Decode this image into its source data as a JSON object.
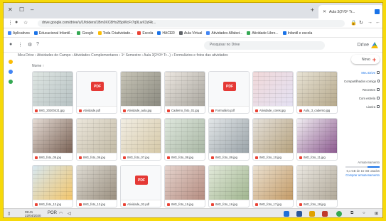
{
  "window": {
    "tab_title": "Aula 3(2ª/3ª Tr...",
    "new_tab": "+",
    "minimize": "–",
    "maximize": "☐",
    "close": "✕"
  },
  "address_bar": {
    "url": "drive.google.com/drive/u/1/folders/1Bm0XC8Hx2l5pWcFr7q9LwX3zRk..."
  },
  "bookmarks": [
    {
      "label": "Aplicativos",
      "color": "#4285f4"
    },
    {
      "label": "Educacional Infantil...",
      "color": "#1a73e8"
    },
    {
      "label": "Google",
      "color": "#34a853"
    },
    {
      "label": "Toda Criatividade...",
      "color": "#fbbc04"
    },
    {
      "label": "Escola",
      "color": "#ea4335"
    },
    {
      "label": "HACER",
      "color": "#1a73e8"
    },
    {
      "label": "Aula Virtual",
      "color": "#5f6368"
    },
    {
      "label": "Atividades Alfabet...",
      "color": "#4285f4"
    },
    {
      "label": "Atividade Libro...",
      "color": "#34a853"
    },
    {
      "label": "Infantil e escola",
      "color": "#1a73e8"
    }
  ],
  "drive": {
    "logo_text": "Drive",
    "search_placeholder": "Pesquisar no Drive",
    "path": "Meu Drive  ›  Atividades do Campo  ›  Atividades Complementares  ›  1º Semestre  ›  Aula 3(2ª/3ª Tr...)  ›  Formulários e fotos das atividades"
  },
  "sidebar": {
    "new_label": "Novo",
    "items": [
      {
        "label": "Meu Drive",
        "active": true
      },
      {
        "label": "Compartilhados comigo",
        "active": false
      },
      {
        "label": "Recentes",
        "active": false
      },
      {
        "label": "Com estrela",
        "active": false
      },
      {
        "label": "Lixeira",
        "active": false
      }
    ],
    "storage_label": "Armazenamento",
    "storage_used_fraction": 0.35,
    "storage_text": "6,1 GB de 15 GB usados",
    "storage_link": "Comprar armazenamento"
  },
  "grid": {
    "header_name": "Nome",
    "header_sort": "↑",
    "files": [
      {
        "name": "IMG_20200421.jpg",
        "type": "image",
        "colors": [
          "#dfe6e3",
          "#b7c2c3"
        ],
        "icon_color": "#ea4335"
      },
      {
        "name": "Atividade.pdf",
        "type": "pdf",
        "icon_color": "#ea4335"
      },
      {
        "name": "Atividade_aula.jpg",
        "type": "image",
        "colors": [
          "#c9c6b8",
          "#8b8a80"
        ],
        "icon_color": "#ea4335"
      },
      {
        "name": "Caderno_foto_01.jpg",
        "type": "image",
        "colors": [
          "#ede8e2",
          "#a9a69e"
        ],
        "icon_color": "#ea4335"
      },
      {
        "name": "Formulário.pdf",
        "type": "pdf",
        "icon_color": "#ea4335"
      },
      {
        "name": "Atividade_cores.jpg",
        "type": "image",
        "colors": [
          "#f1d9d9",
          "#e4e1f3"
        ],
        "icon_color": "#ea4335"
      },
      {
        "name": "Aula_3_caderno.jpg",
        "type": "image",
        "colors": [
          "#e8e3d5",
          "#b6a98c"
        ],
        "icon_color": "#ea4335"
      },
      {
        "name": "IMG_foto_05.jpg",
        "type": "image",
        "colors": [
          "#e6ddd6",
          "#7a6255"
        ],
        "icon_color": "#ea4335"
      },
      {
        "name": "IMG_foto_06.jpg",
        "type": "image",
        "colors": [
          "#ece7dc",
          "#c2baa5"
        ],
        "icon_color": "#ea4335"
      },
      {
        "name": "IMG_foto_07.jpg",
        "type": "image",
        "colors": [
          "#f2eee4",
          "#d6c9a8"
        ],
        "icon_color": "#ea4335"
      },
      {
        "name": "IMG_foto_08.jpg",
        "type": "image",
        "colors": [
          "#dfe8de",
          "#a9b7a4"
        ],
        "icon_color": "#ea4335"
      },
      {
        "name": "IMG_foto_09.jpg",
        "type": "image",
        "colors": [
          "#e2e6e8",
          "#9aa3a8"
        ],
        "icon_color": "#ea4335"
      },
      {
        "name": "IMG_foto_10.jpg",
        "type": "image",
        "colors": [
          "#e6e2dc",
          "#b6a27d"
        ],
        "icon_color": "#ea4335"
      },
      {
        "name": "IMG_foto_11.jpg",
        "type": "image",
        "colors": [
          "#f1eef2",
          "#8c5a8f"
        ],
        "icon_color": "#ea4335"
      },
      {
        "name": "IMG_foto_12.jpg",
        "type": "image",
        "colors": [
          "#d7e8f2",
          "#f3c66b"
        ],
        "icon_color": "#ea4335"
      },
      {
        "name": "IMG_foto_13.jpg",
        "type": "image",
        "colors": [
          "#dfdcd4",
          "#9a8f7f"
        ],
        "icon_color": "#ea4335"
      },
      {
        "name": "Atividade_02.pdf",
        "type": "pdf",
        "icon_color": "#ea4335"
      },
      {
        "name": "IMG_foto_15.jpg",
        "type": "image",
        "colors": [
          "#e6d5cf",
          "#b58c80"
        ],
        "icon_color": "#ea4335"
      },
      {
        "name": "IMG_foto_16.jpg",
        "type": "image",
        "colors": [
          "#e3eadb",
          "#a0b58f"
        ],
        "icon_color": "#ea4335"
      },
      {
        "name": "IMG_foto_17.jpg",
        "type": "image",
        "colors": [
          "#ebe2d3",
          "#c49b66"
        ],
        "icon_color": "#ea4335"
      },
      {
        "name": "IMG_foto_18.jpg",
        "type": "image",
        "colors": [
          "#ece9e3",
          "#b0a898"
        ],
        "icon_color": "#ea4335"
      }
    ]
  },
  "taskbar": {
    "time": "09:41",
    "date": "22/04/2020",
    "lang": "POR"
  },
  "colors": {
    "frame_border": "#f6d90a",
    "accent": "#1a73e8",
    "pdf_red": "#e53935"
  }
}
